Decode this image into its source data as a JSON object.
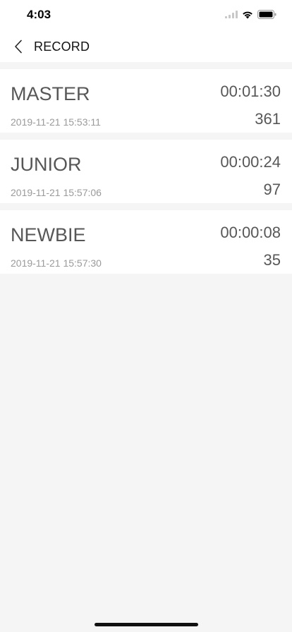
{
  "status_bar": {
    "time": "4:03"
  },
  "nav": {
    "back_icon": "chevron-left-icon",
    "title": "RECORD"
  },
  "records": [
    {
      "level": "MASTER",
      "date": "2019-11-21 15:53:11",
      "time": "00:01:30",
      "score": "361"
    },
    {
      "level": "JUNIOR",
      "date": "2019-11-21 15:57:06",
      "time": "00:00:24",
      "score": "97"
    },
    {
      "level": "NEWBIE",
      "date": "2019-11-21 15:57:30",
      "time": "00:00:08",
      "score": "35"
    }
  ],
  "colors": {
    "background": "#f5f5f5",
    "card": "#ffffff",
    "primary_text": "#575757",
    "secondary_text": "#9a9a9a"
  }
}
